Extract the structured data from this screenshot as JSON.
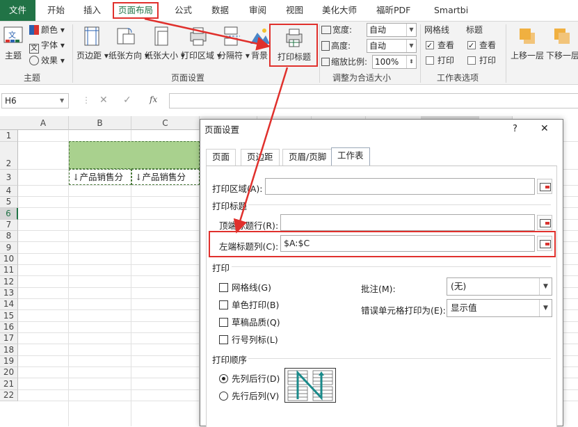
{
  "tabs": {
    "file": "文件",
    "items": [
      "开始",
      "插入",
      "页面布局",
      "公式",
      "数据",
      "审阅",
      "视图",
      "美化大师",
      "福昕PDF",
      "Smartbi"
    ],
    "active_index": 2
  },
  "ribbon": {
    "theme": {
      "main": "主题",
      "colors": "颜色",
      "fonts": "字体",
      "effects": "效果",
      "group": "主题"
    },
    "page_setup": {
      "margins": "页边距",
      "orientation": "纸张方向",
      "size": "纸张大小",
      "print_area": "打印区域",
      "breaks": "分隔符",
      "background": "背景",
      "print_titles": "打印标题",
      "group": "页面设置"
    },
    "scale": {
      "width_label": "宽度:",
      "width_value": "自动",
      "height_label": "高度:",
      "height_value": "自动",
      "scale_label": "缩放比例:",
      "scale_value": "100%",
      "group": "调整为合适大小"
    },
    "sheet_options": {
      "gridlines": "网格线",
      "headings": "标题",
      "view": "查看",
      "print": "打印",
      "group": "工作表选项"
    },
    "arrange": {
      "bring_forward": "上移一层",
      "send_backward": "下移一层"
    }
  },
  "formula_bar": {
    "name_box": "H6",
    "fx": "fx"
  },
  "grid": {
    "columns": [
      "A",
      "B",
      "C",
      "D",
      "E",
      "F",
      "G",
      "H",
      "I"
    ],
    "rows": [
      "1",
      "2",
      "3",
      "4",
      "5",
      "6",
      "7",
      "8",
      "9",
      "10",
      "11",
      "12",
      "13",
      "14",
      "15",
      "16",
      "17",
      "18",
      "19",
      "20",
      "21",
      "22"
    ],
    "cells": {
      "B3": "↓产品销售分",
      "C3": "↓产品销售分"
    },
    "header_fill": "#a9d18e"
  },
  "dialog": {
    "title": "页面设置",
    "help": "?",
    "close": "✕",
    "tabs": [
      "页面",
      "页边距",
      "页眉/页脚",
      "工作表"
    ],
    "active_tab": 3,
    "print_area_label": "打印区域(A):",
    "print_area_value": "",
    "print_titles_section": "打印标题",
    "rows_to_repeat_label": "顶端标题行(R):",
    "rows_to_repeat_value": "",
    "cols_to_repeat_label": "左端标题列(C):",
    "cols_to_repeat_value": "$A:$C",
    "print_section": "打印",
    "gridlines": "网格线(G)",
    "black_white": "单色打印(B)",
    "draft": "草稿品质(Q)",
    "row_col_headings": "行号列标(L)",
    "comments_label": "批注(M):",
    "comments_value": "(无)",
    "errors_label": "错误单元格打印为(E):",
    "errors_value": "显示值",
    "page_order_section": "打印顺序",
    "down_then_over": "先列后行(D)",
    "over_then_down": "先行后列(V)"
  },
  "colors": {
    "accent": "#217346",
    "highlight": "#e0302c"
  }
}
